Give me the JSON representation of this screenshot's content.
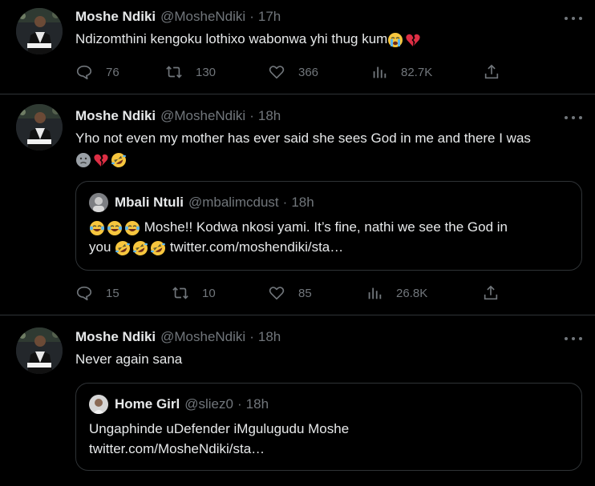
{
  "tweets": [
    {
      "name": "Moshe Ndiki",
      "handle": "@MosheNdiki",
      "separator": "·",
      "time": "17h",
      "text": "Ndizomthini kengoku lothixo wabonwa yhi thug kum",
      "emojis": [
        "loudly-crying-face",
        "broken-heart"
      ],
      "stats": {
        "replies": "76",
        "retweets": "130",
        "likes": "366",
        "views": "82.7K"
      }
    },
    {
      "name": "Moshe Ndiki",
      "handle": "@MosheNdiki",
      "separator": "·",
      "time": "18h",
      "text": "Yho not even my mother has ever said she sees God in me and there I was",
      "emojis": [
        "slightly-frowning-face",
        "broken-heart",
        "rolling-on-floor-laughing"
      ],
      "quote": {
        "name": "Mbali Ntuli",
        "handle": "@mbalimcdust",
        "separator": "·",
        "time": "18h",
        "text_part1": "Moshe!! Kodwa nkosi yami. It’s fine, nathi we see the God in",
        "text_part2": "you",
        "link": "twitter.com/moshendiki/sta…",
        "lead_emojis": [
          "face-with-tears-of-joy",
          "face-with-tears-of-joy",
          "face-with-tears-of-joy"
        ],
        "trail_emojis": [
          "rolling-on-floor-laughing",
          "rolling-on-floor-laughing",
          "rolling-on-floor-laughing"
        ]
      },
      "stats": {
        "replies": "15",
        "retweets": "10",
        "likes": "85",
        "views": "26.8K"
      }
    },
    {
      "name": "Moshe Ndiki",
      "handle": "@MosheNdiki",
      "separator": "·",
      "time": "18h",
      "text": "Never again sana",
      "quote": {
        "name": "Home Girl",
        "handle": "@sliez0",
        "separator": "·",
        "time": "18h",
        "text": "Ungaphinde uDefender iMgulugudu Moshe",
        "link": "twitter.com/MosheNdiki/sta…"
      }
    }
  ],
  "icons": {
    "reply": "comment-bubble-icon",
    "retweet": "retweet-arrows-icon",
    "like": "heart-icon",
    "views": "bar-chart-icon",
    "share": "share-upload-icon",
    "more": "more-dots-icon"
  },
  "colors": {
    "background": "#000000",
    "text": "#e7e9ea",
    "muted": "#71767b",
    "border": "#2f3336"
  }
}
